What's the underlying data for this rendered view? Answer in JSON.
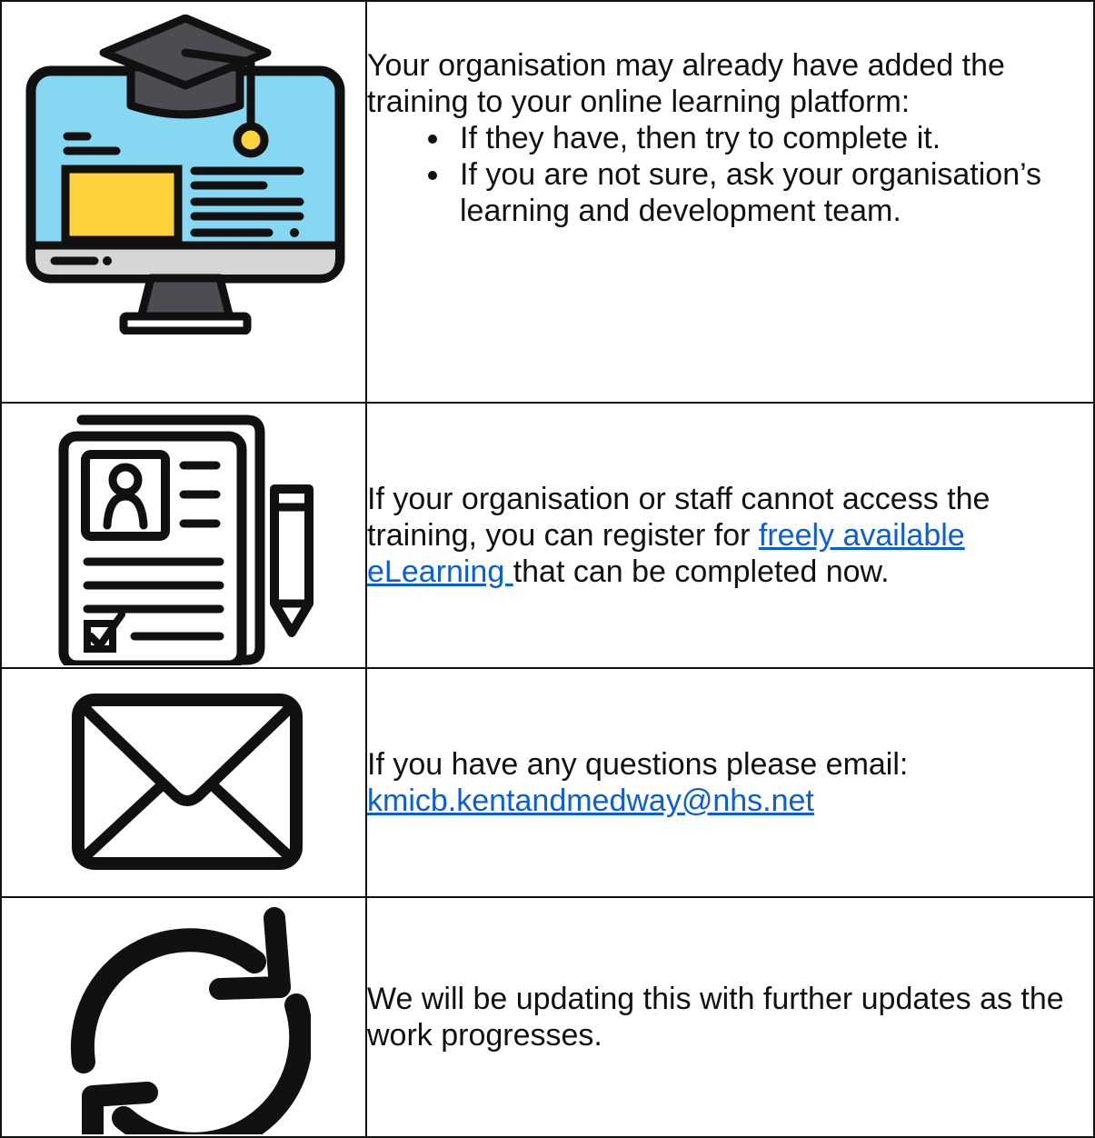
{
  "rows": [
    {
      "icon": "computer-graduation-cap-icon",
      "intro": "Your organisation may already have added the training to your online learning platform:",
      "bullets": [
        "If they have, then try to complete it.",
        "If you are not sure, ask your organisation’s learning and development team."
      ]
    },
    {
      "icon": "resume-document-pencil-icon",
      "text_before": "If your organisation or staff cannot access the training, you can register for ",
      "link_text": "freely available eLearning ",
      "text_after": "that can be completed now."
    },
    {
      "icon": "envelope-icon",
      "text": "If you have any questions please email:",
      "email": "kmicb.kentandmedway@nhs.net"
    },
    {
      "icon": "refresh-arrows-icon",
      "text": "We will be updating this with further updates as the work progresses."
    }
  ],
  "colors": {
    "link": "#0b5ed7",
    "screen_blue": "#86d8f2",
    "card_yellow": "#fdd23c",
    "stand_gray": "#4c4c52",
    "bezel_gray": "#d6d6d6"
  }
}
